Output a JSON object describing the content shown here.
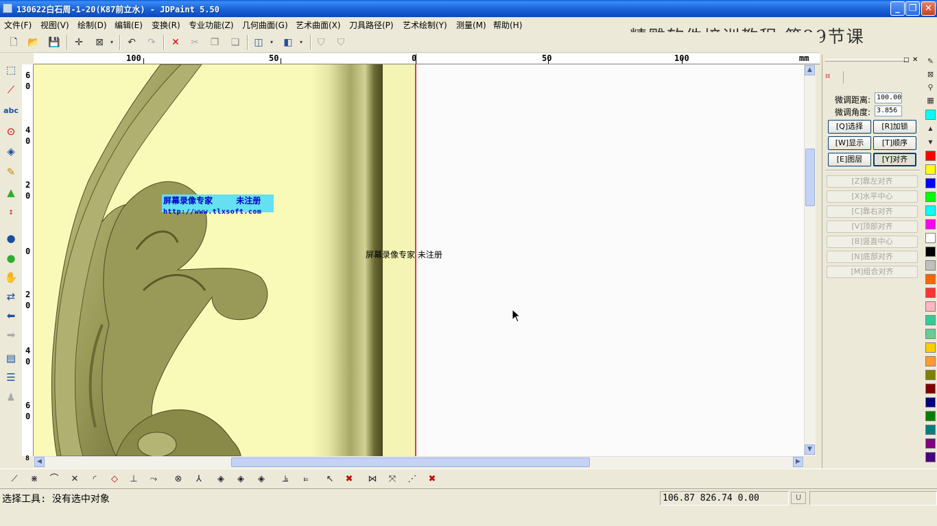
{
  "window": {
    "title": "130622白石周-1-20(K87前立水) - JDPaint 5.50",
    "controls": {
      "minimize": "_",
      "maximize": "❐",
      "close": "✕"
    }
  },
  "menu": [
    "文件(F)",
    "视图(V)",
    "绘制(D)",
    "编辑(E)",
    "变换(R)",
    "专业功能(Z)",
    "几何曲面(G)",
    "艺术曲面(X)",
    "刀具路径(P)",
    "艺术绘制(Y)",
    "测量(M)",
    "帮助(H)"
  ],
  "course_title": "精雕软件培训教程 第29节课",
  "ruler": {
    "unit": "mm",
    "h_labels": [
      "100",
      "50",
      "0",
      "50",
      "100"
    ],
    "v_labels": [
      "6\n0",
      "4\n0",
      "2\n0",
      "0",
      "2\n0",
      "4\n0",
      "6\n0",
      "8"
    ]
  },
  "canvas": {
    "watermark_title": "屏幕录像专家",
    "watermark_unreg": "未注册",
    "watermark_url": "http://www.tlxsoft.com",
    "watermark_center": "屏幕录像专家 未注册"
  },
  "panel": {
    "tab_icon": "node-edit-icon",
    "distance_label": "微调距离:",
    "distance_value": "100.00",
    "angle_label": "微调角度:",
    "angle_value": "3.856",
    "buttons": {
      "select": "[Q]选择",
      "lock": "[R]加锁",
      "show": "[W]显示",
      "order": "[T]顺序",
      "layer": "[E]图层",
      "align": "[Y]对齐"
    },
    "align_options": [
      "[Z]靠左对齐",
      "[X]水平中心",
      "[C]靠右对齐",
      "[V]顶部对齐",
      "[B]竖直中心",
      "[N]底部对齐",
      "[M]组合对齐"
    ]
  },
  "palette": [
    "#00ffff",
    "#ff0000",
    "#ffff00",
    "#0000ff",
    "#00ff00",
    "#00ffff",
    "#ff00ff",
    "#ffffff",
    "#000000",
    "#c0c0c0",
    "#ff6600",
    "#ff3333",
    "#ffb6c1",
    "#33cc99",
    "#66cc99",
    "#ffcc00",
    "#ff9933",
    "#808000",
    "#800000",
    "#000080",
    "#008000",
    "#008080",
    "#800080",
    "#4b0082"
  ],
  "status": {
    "message": "选择工具: 没有选中对象",
    "coordinates": "106.87 826.74 0.00",
    "u_label": "U"
  },
  "colors": {
    "canvas_bg": "#fbfbfb",
    "relief_bg": "#fafab8",
    "relief": "#9a9a52",
    "red_guide": "#d00000",
    "title_blue": "#0a5bd6"
  }
}
